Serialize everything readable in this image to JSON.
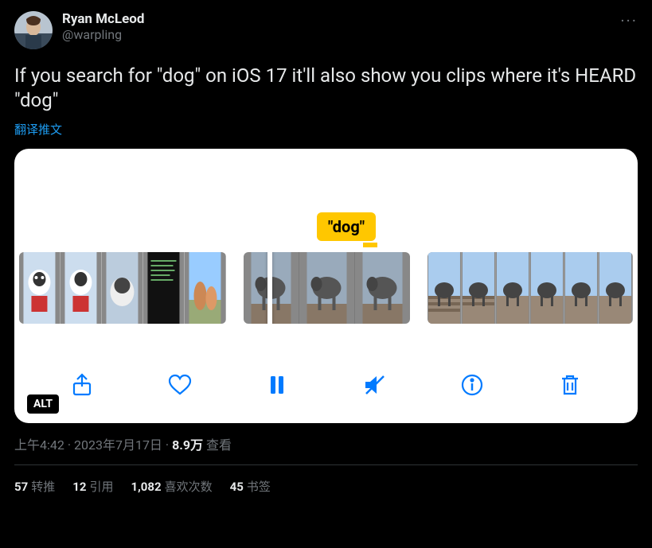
{
  "author": {
    "display_name": "Ryan McLeod",
    "handle": "@warpling"
  },
  "more_label": "···",
  "body": "If you search for \"dog\" on iOS 17 it'll also show you clips where it's HEARD \"dog\"",
  "translate_label": "翻译推文",
  "media": {
    "tooltip": "\"dog\"",
    "alt_badge": "ALT",
    "toolbar": {
      "share": "share-icon",
      "like": "heart-icon",
      "pause": "pause-icon",
      "mute": "mute-icon",
      "info": "info-icon",
      "trash": "trash-icon"
    }
  },
  "meta": {
    "time": "上午4:42",
    "date": "2023年7月17日",
    "separator": " · ",
    "views_num": "8.9万",
    "views_label": " 查看"
  },
  "stats": {
    "retweets_num": "57",
    "retweets_label": "转推",
    "quotes_num": "12",
    "quotes_label": "引用",
    "likes_num": "1,082",
    "likes_label": "喜欢次数",
    "bookmarks_num": "45",
    "bookmarks_label": "书签"
  }
}
